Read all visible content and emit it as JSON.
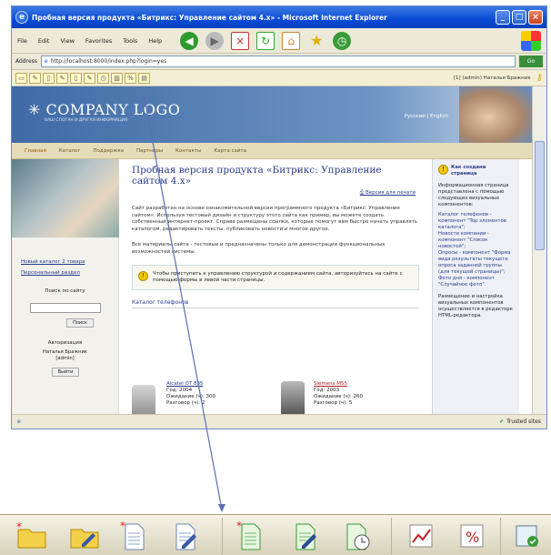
{
  "window": {
    "title": "Пробная версия продукта «Битрикс: Управление сайтом 4.x» - Microsoft Internet Explorer",
    "controls": [
      "_",
      "□",
      "×"
    ]
  },
  "menubar": {
    "items": [
      "File",
      "Edit",
      "View",
      "Favorites",
      "Tools",
      "Help"
    ]
  },
  "address": {
    "label": "Address",
    "url": "http://localhost:8000/index.php?login=yes",
    "go": "Go"
  },
  "adminbar": {
    "user": "[1] (admin) Наталья Бражник"
  },
  "site": {
    "logo": "COMPANY LOGO",
    "slogan": "ВАШ СЛОГАН И ДРУГАЯ ИНФОРМАЦИЯ",
    "lang": "Русский | English",
    "nav": [
      "Главная",
      "Каталог",
      "Поддержка",
      "Партнеры",
      "Контакты",
      "Карта сайта"
    ]
  },
  "left": {
    "links": [
      "Новый каталог 2 товара",
      "Персональный раздел"
    ],
    "search_title": "Поиск по сайту",
    "search_button": "Поиск",
    "auth_title": "Авторизация",
    "user_name": "Наталья Бражник",
    "user_login": "[admin]",
    "logout": "Выйти"
  },
  "main": {
    "title": "Пробная версия продукта «Битрикс: Управление сайтом 4.x»",
    "print_link": "Версия для печати",
    "para1": "Сайт разработан на основе ознакомительной версии программного продукта «Битрикс: Управление сайтом». Используя тестовый дизайн и структуру этого сайта как пример, вы можете создать собственный интернет-проект. Справа размещены ссылки, которые помогут вам быстро начать управлять каталогом, редактировать тексты, публиковать новости и многое другое.",
    "para2": "Все материалы сайта - тестовые и предназначены только для демонстрации функциональных возможностей системы.",
    "note": "Чтобы приступить к управлению структурой и содержанием сайта, авторизуйтесь на сайте с помощью формы в левой части страницы.",
    "catalog_title": "Каталог телефонов",
    "products": [
      {
        "name": "Alcatel OT 835",
        "year": "Год: 2004",
        "standby": "Ожидание (ч): 300",
        "talk": "Разговор (ч): 2"
      },
      {
        "name": "Siemens M55",
        "year": "Год: 2003",
        "standby": "Ожидание (ч): 260",
        "talk": "Разговор (ч): 5"
      }
    ]
  },
  "right": {
    "title": "Как создана страница",
    "intro": "Информационная страница представлена с помощью следующих визуальных компонентов:",
    "items": [
      "Каталог телефонов - компонент \"Top элементов каталога\";",
      "Новости компании - компонент \"Список новостей\";",
      "Опросы - компонент \"Форма вида результаты текущего опроса заданной группы (для текущей страницы)\";",
      "Фото дня - компонент \"Случайное фото\"."
    ],
    "outro": "Размещение и настройка визуальных компонентов осуществляется в редакторе HTML-редактора."
  },
  "status": {
    "text": "",
    "zone": "Trusted sites"
  },
  "taskbar": {
    "icons": [
      "new-folder-icon",
      "folder-properties-icon",
      "new-page-icon",
      "edit-page-icon",
      "new-page-template-icon",
      "edit-page-html-icon",
      "page-history-icon",
      "chart-icon",
      "percent-icon",
      "control-panel-icon"
    ]
  },
  "colors": {
    "ie_blue": "#0a4bd6",
    "site_blue": "#2a3c8c",
    "banner": "#3f6aa5",
    "nav_bg": "#e5dcb9"
  }
}
